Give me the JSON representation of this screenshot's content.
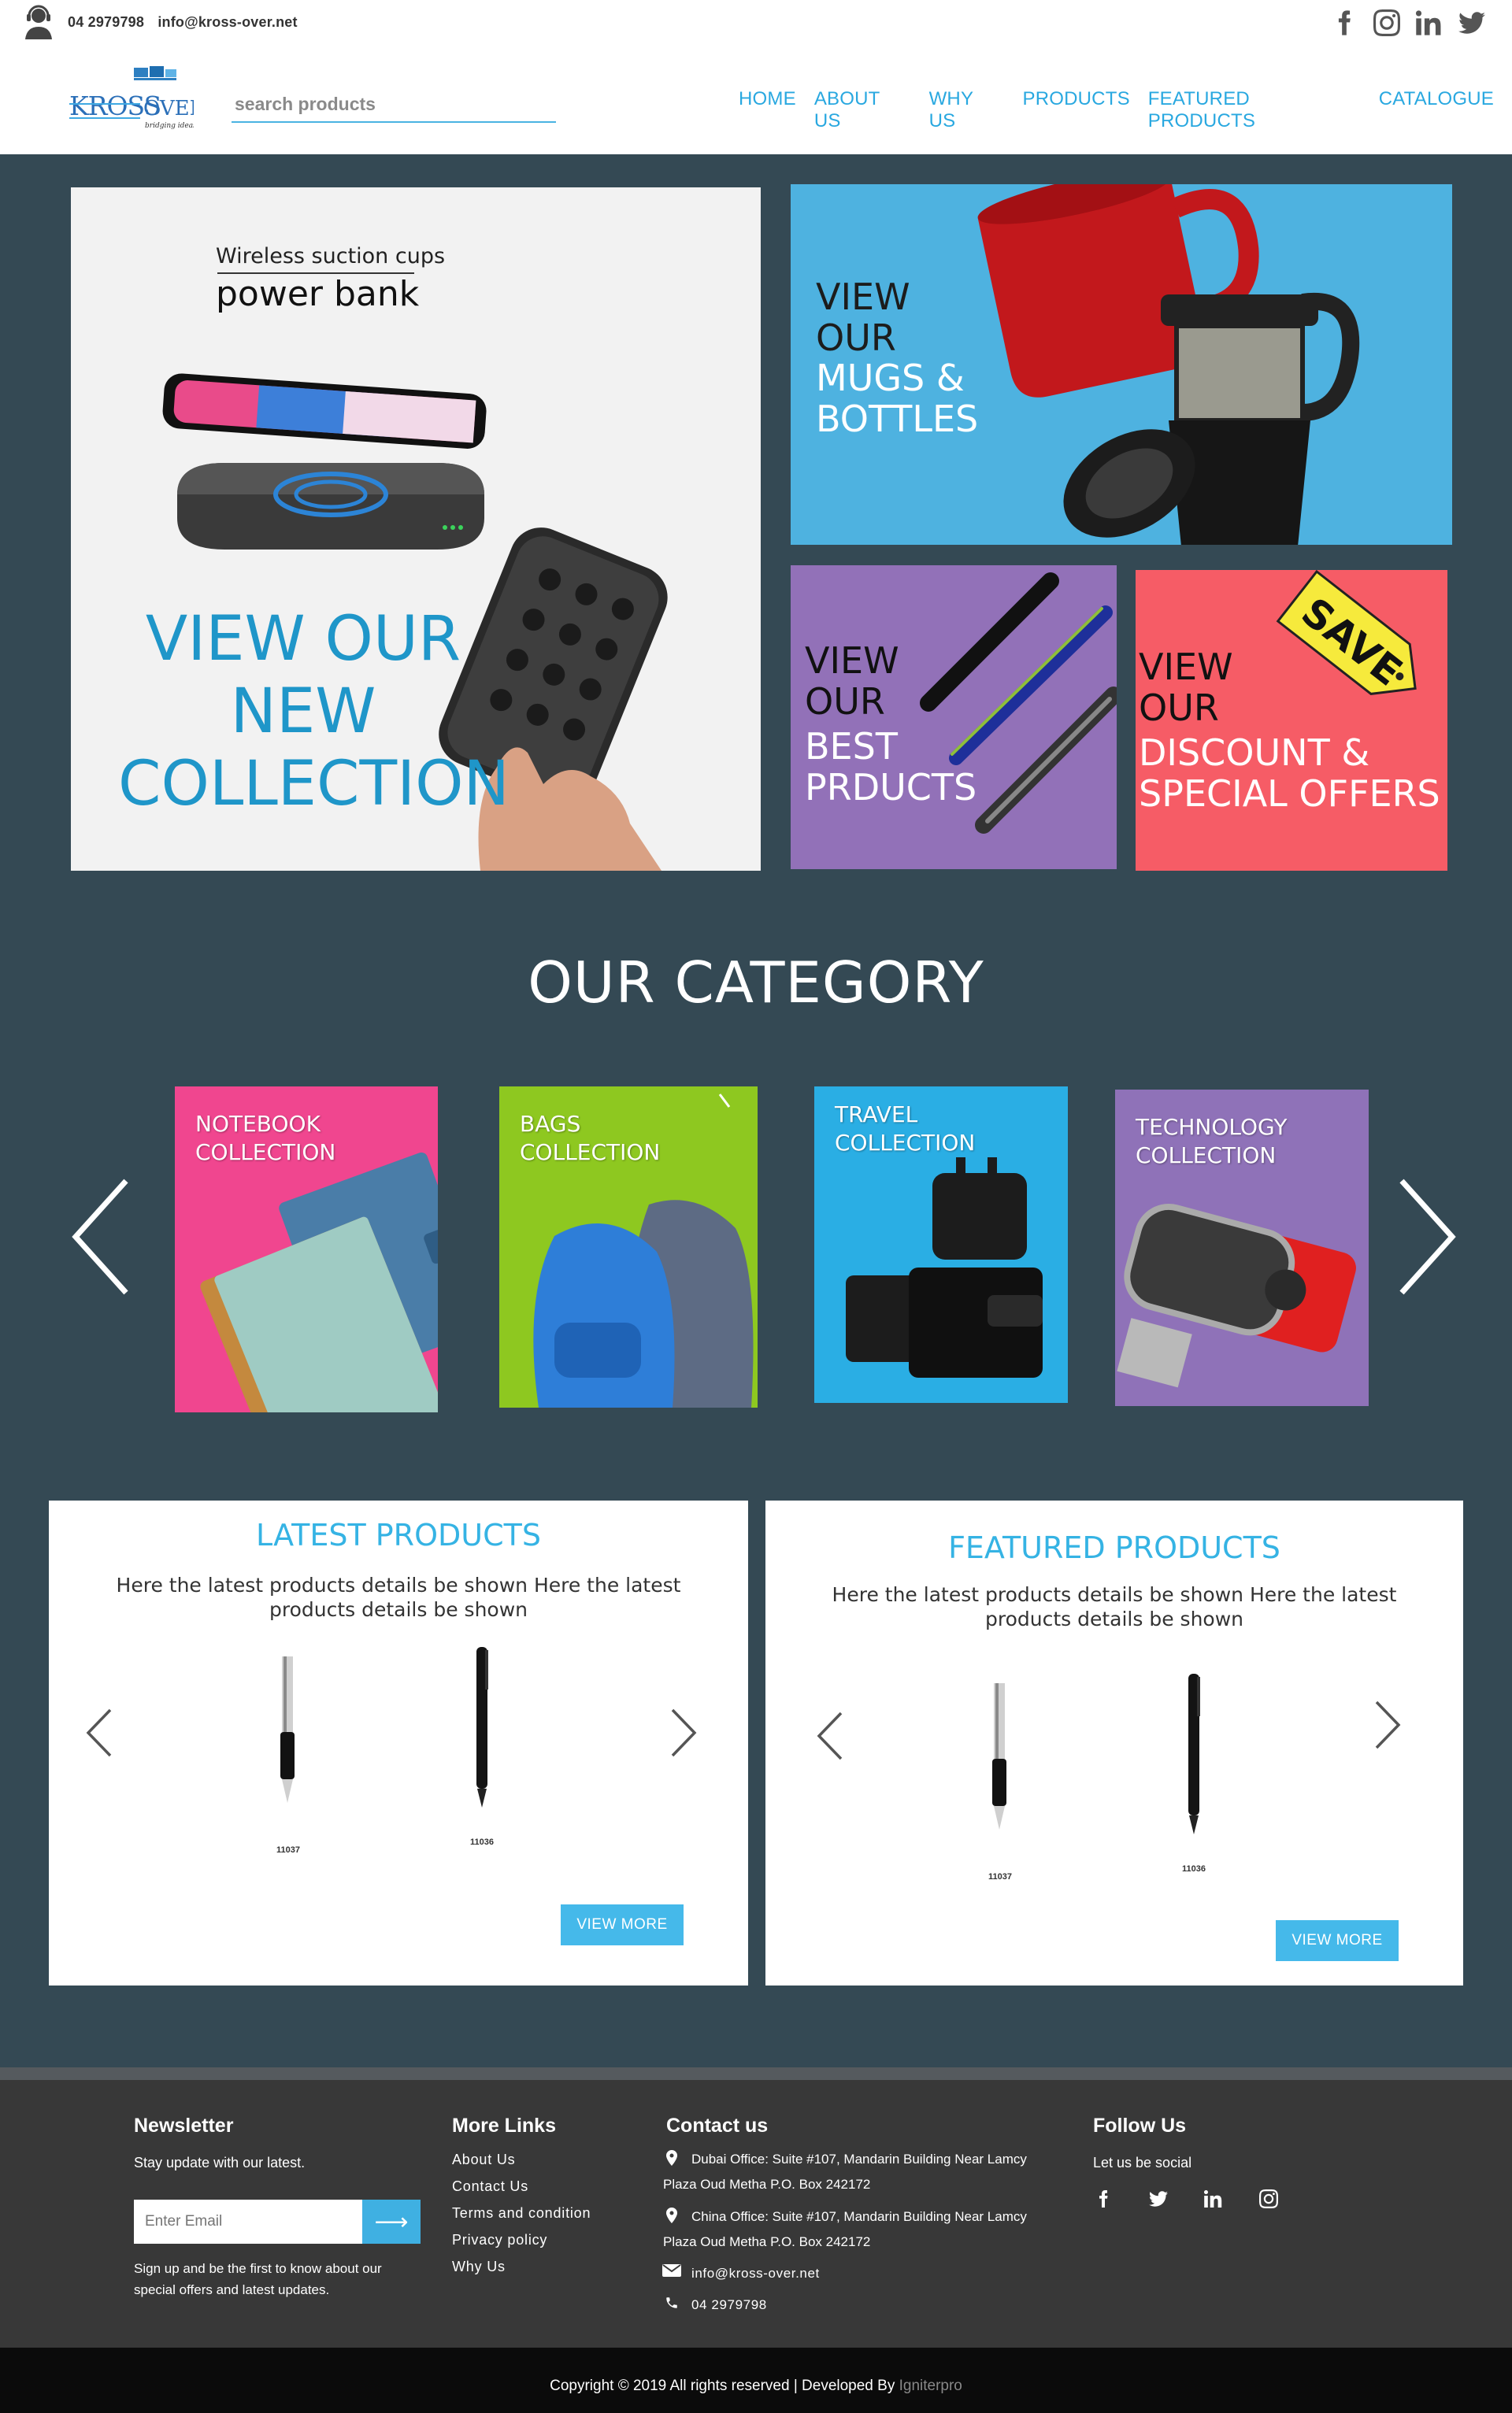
{
  "topbar": {
    "phone": "04 2979798",
    "email": "info@kross-over.net",
    "social": [
      "facebook-icon",
      "instagram-icon",
      "linkedin-icon",
      "twitter-icon"
    ]
  },
  "header": {
    "logo_text": "KROSSOVER",
    "logo_tagline": "bridging ideas",
    "search_placeholder": "search products",
    "nav": [
      "HOME",
      "ABOUT US",
      "WHY US",
      "PRODUCTS",
      "FEATURED PRODUCTS",
      "CATALOGUE"
    ]
  },
  "hero": {
    "new_collection": {
      "caption1": "Wireless suction cups",
      "caption2": "power bank",
      "label_lines": [
        "VIEW OUR",
        "NEW",
        "COLLECTION"
      ]
    },
    "mugs": {
      "line1": "VIEW",
      "line2": "OUR",
      "line3": "MUGS &",
      "line4": "BOTTLES"
    },
    "best": {
      "line1": "VIEW",
      "line2": "OUR",
      "line3": "BEST",
      "line4": "PRDUCTS"
    },
    "discount": {
      "line1": "VIEW",
      "line2": "OUR",
      "line3": "DISCOUNT &",
      "line4": "SPECIAL OFFERS",
      "tag": "SAVE"
    }
  },
  "category": {
    "title": "OUR CATEGORY",
    "cards": [
      {
        "line1": "NOTEBOOK",
        "line2": "COLLECTION",
        "color": "#f0468f"
      },
      {
        "line1": "BAGS",
        "line2": "COLLECTION",
        "color": "#8ec820"
      },
      {
        "line1": "TRAVEL",
        "line2": "COLLECTION",
        "color": "#2aaee4"
      },
      {
        "line1": "TECHNOLOGY",
        "line2": "COLLECTION",
        "color": "#8f72b8"
      }
    ]
  },
  "latest": {
    "title": "LATEST PRODUCTS",
    "desc": "Here the latest products details be shown Here the latest products details be shown",
    "items": [
      "11037",
      "11036"
    ],
    "button": "VIEW MORE"
  },
  "featured": {
    "title": "FEATURED PRODUCTS",
    "desc": "Here the latest products details be shown Here the latest products details be shown",
    "items": [
      "11037",
      "11036"
    ],
    "button": "VIEW MORE"
  },
  "footer": {
    "newsletter": {
      "title": "Newsletter",
      "subtitle": "Stay update with our latest.",
      "placeholder": "Enter Email",
      "note_line1": "Sign up and be the first to know about our",
      "note_line2": "special offers and latest updates."
    },
    "links": {
      "title": "More Links",
      "items": [
        "About Us",
        "Contact Us",
        "Terms and condition",
        "Privacy policy",
        "Why Us"
      ]
    },
    "contact": {
      "title": "Contact us",
      "dubai_line1": "Dubai Office: Suite #107, Mandarin Building Near Lamcy",
      "dubai_line2": "Plaza Oud Metha P.O. Box 242172",
      "china_line1": "China Office: Suite #107, Mandarin Building Near Lamcy",
      "china_line2": "Plaza Oud Metha P.O. Box 242172",
      "email": "info@kross-over.net",
      "phone": "04 2979798"
    },
    "follow": {
      "title": "Follow Us",
      "subtitle": "Let us be social",
      "icons": [
        "facebook-icon",
        "twitter-icon",
        "linkedin-icon",
        "instagram-icon"
      ]
    }
  },
  "copyright": {
    "text": "Copyright © 2019 All rights reserved | Developed By ",
    "developer": "Igniterpro"
  },
  "colors": {
    "accent": "#29a8e0",
    "main_bg": "#344954",
    "mugs_tile": "#4eb2e0",
    "best_tile": "#9271b8",
    "discount_tile": "#f65c66",
    "footer_bg": "#383838"
  }
}
